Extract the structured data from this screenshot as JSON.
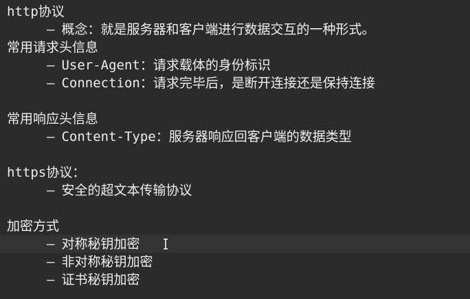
{
  "doc": {
    "http_heading": "http协议",
    "http_concept": "概念：就是服务器和客户端进行数据交互的一种形式。",
    "req_heading": "常用请求头信息",
    "req_ua": "User-Agent：请求载体的身份标识",
    "req_conn": "Connection：请求完毕后，是断开连接还是保持连接",
    "resp_heading": "常用响应头信息",
    "resp_ct": "Content-Type：服务器响应回客户端的数据类型",
    "https_heading": "https协议：",
    "https_desc": "安全的超文本传输协议",
    "enc_heading": "加密方式",
    "enc_sym": "对称秘钥加密",
    "enc_asym": "非对称秘钥加密",
    "enc_cert": "证书秘钥加密",
    "dash": "–"
  },
  "colors": {
    "background": "#2b2b2d",
    "text": "#eceff0",
    "current_line": "#333336"
  }
}
